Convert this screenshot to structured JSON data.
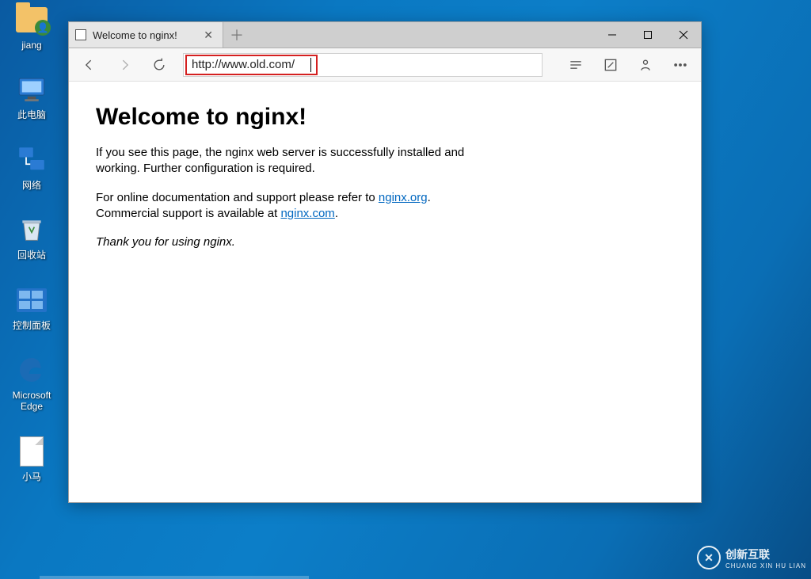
{
  "desktop": {
    "icons": [
      {
        "name": "user-folder",
        "label": "jiang"
      },
      {
        "name": "this-pc",
        "label": "此电脑"
      },
      {
        "name": "network",
        "label": "网络"
      },
      {
        "name": "recycle-bin",
        "label": "回收站"
      },
      {
        "name": "control-panel",
        "label": "控制面板"
      },
      {
        "name": "ms-edge",
        "label": "Microsoft Edge"
      },
      {
        "name": "file-xiaoma",
        "label": "小马"
      }
    ]
  },
  "browser": {
    "tab_title": "Welcome to nginx!",
    "address": "http://www.old.com/"
  },
  "page": {
    "heading": "Welcome to nginx!",
    "p1": "If you see this page, the nginx web server is successfully installed and working. Further configuration is required.",
    "p2a": "For online documentation and support please refer to ",
    "p2_link1": "nginx.org",
    "p2b": ".",
    "p3a": "Commercial support is available at ",
    "p3_link": "nginx.com",
    "p3b": ".",
    "thanks": "Thank you for using nginx."
  },
  "watermark": {
    "brand": "创新互联",
    "sub": "CHUANG XIN HU LIAN"
  }
}
